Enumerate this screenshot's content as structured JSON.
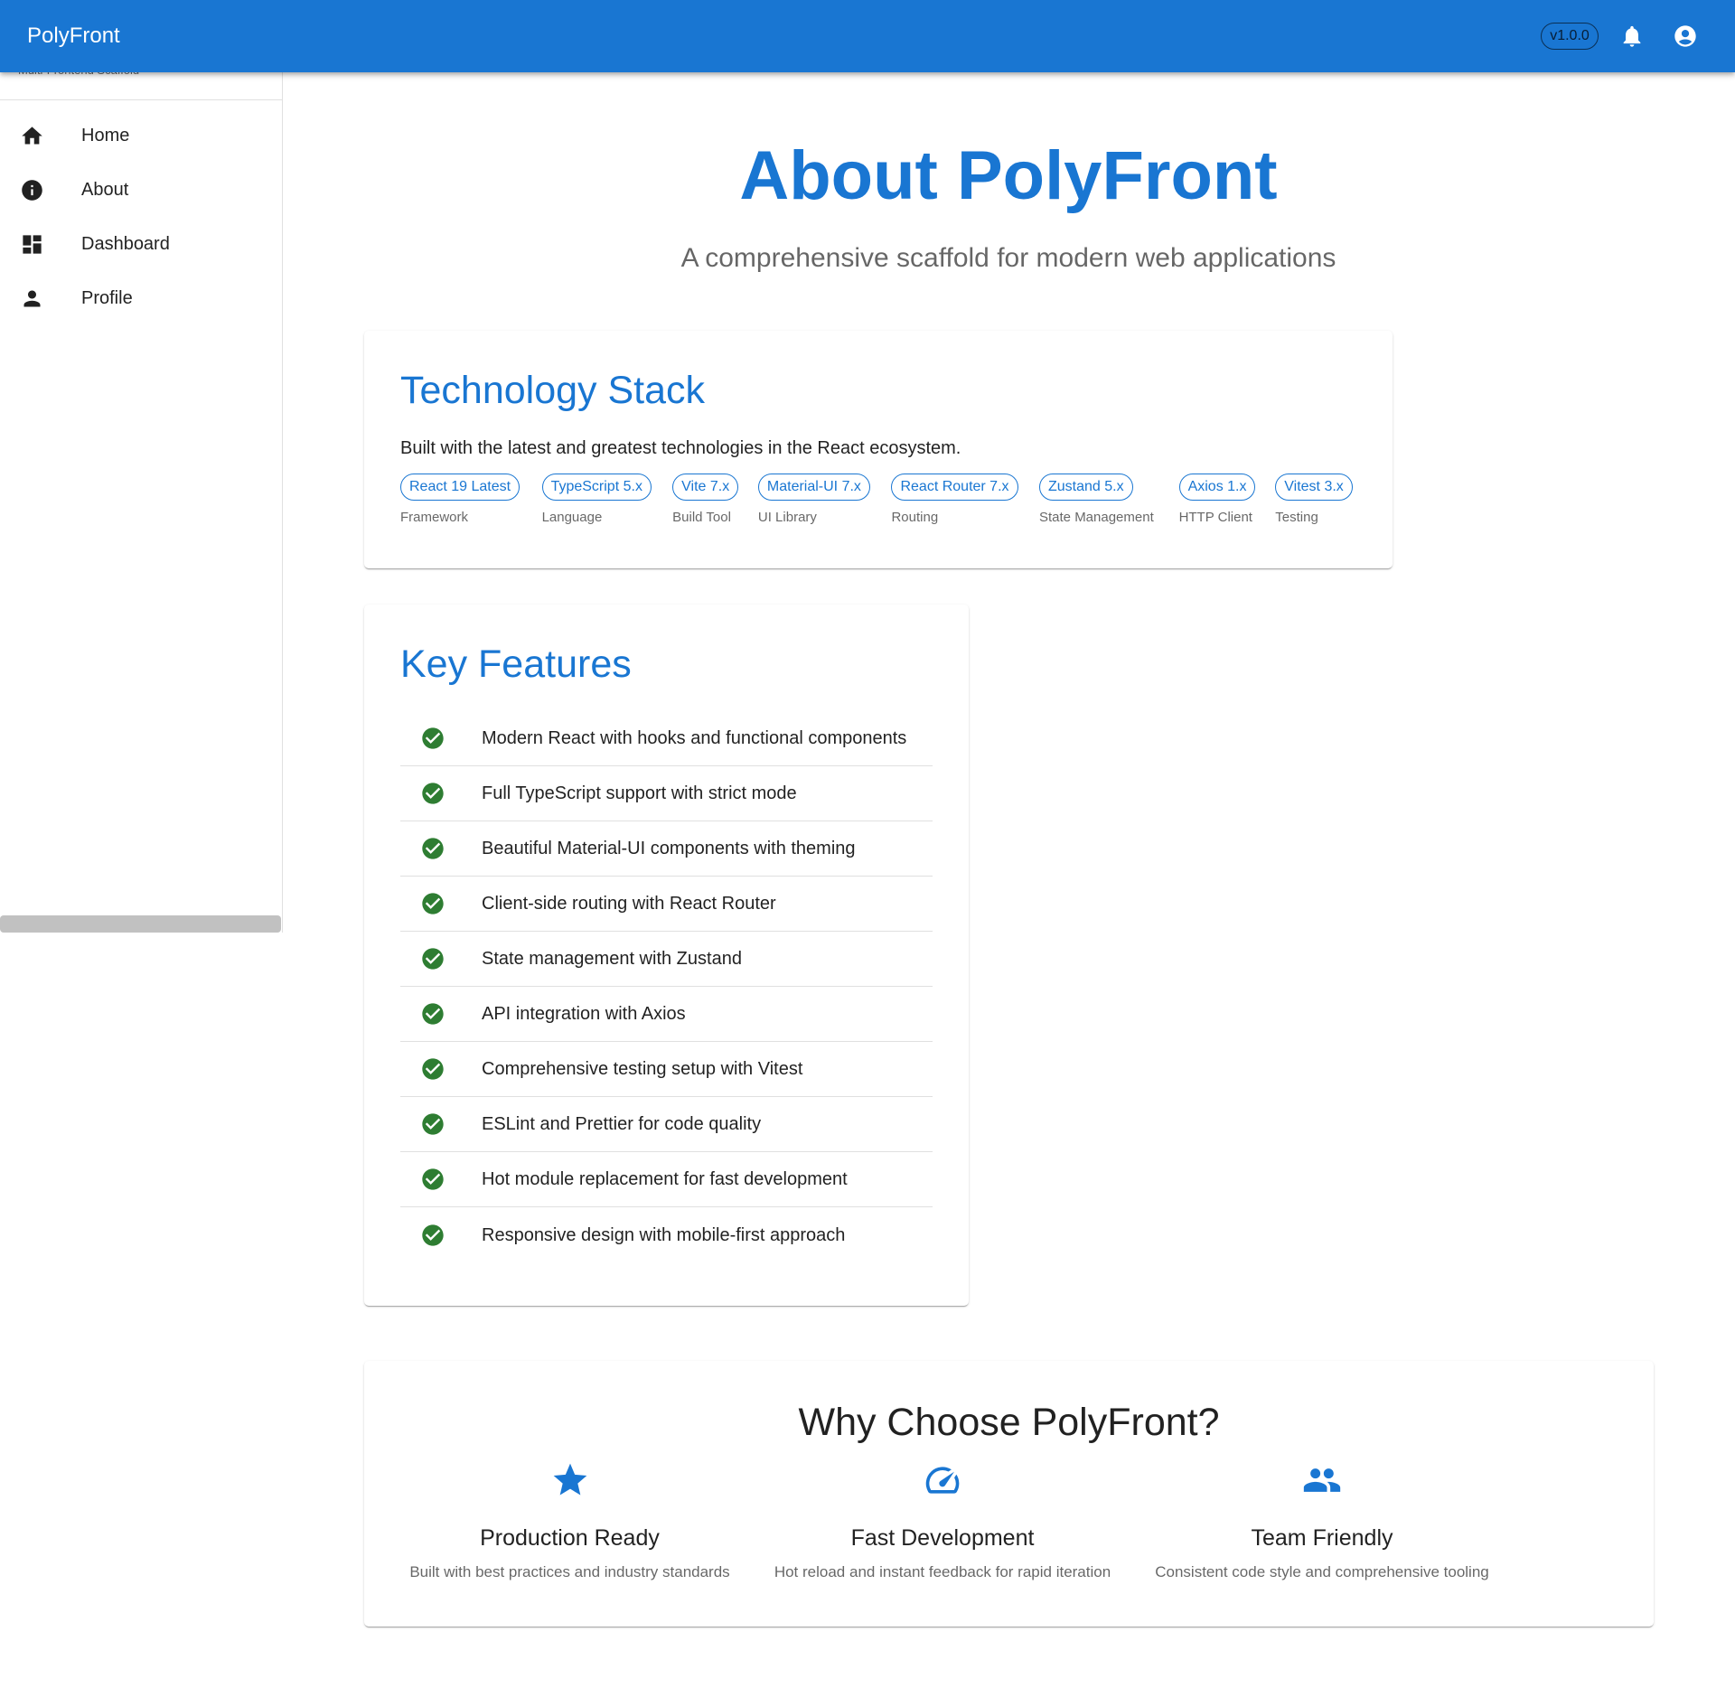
{
  "appbar": {
    "title": "PolyFront",
    "version": "v1.0.0",
    "icons": [
      "notifications-icon",
      "account-icon"
    ]
  },
  "sidebar": {
    "subtitle": "Multi-Frontend Scaffold",
    "items": [
      {
        "label": "Home",
        "icon": "home-icon"
      },
      {
        "label": "About",
        "icon": "info-icon"
      },
      {
        "label": "Dashboard",
        "icon": "dashboard-icon"
      },
      {
        "label": "Profile",
        "icon": "person-icon"
      }
    ]
  },
  "hero": {
    "title": "About PolyFront",
    "subtitle": "A comprehensive scaffold for modern web applications"
  },
  "tech": {
    "heading": "Technology Stack",
    "description": "Built with the latest and greatest technologies in the React ecosystem.",
    "items": [
      {
        "chip": "React 19 Latest",
        "category": "Framework"
      },
      {
        "chip": "TypeScript 5.x",
        "category": "Language"
      },
      {
        "chip": "Vite 7.x",
        "category": "Build Tool"
      },
      {
        "chip": "Material-UI 7.x",
        "category": "UI Library"
      },
      {
        "chip": "React Router 7.x",
        "category": "Routing"
      },
      {
        "chip": "Zustand 5.x",
        "category": "State Management"
      },
      {
        "chip": "Axios 1.x",
        "category": "HTTP Client"
      },
      {
        "chip": "Vitest 3.x",
        "category": "Testing"
      }
    ]
  },
  "features": {
    "heading": "Key Features",
    "items": [
      "Modern React with hooks and functional components",
      "Full TypeScript support with strict mode",
      "Beautiful Material-UI components with theming",
      "Client-side routing with React Router",
      "State management with Zustand",
      "API integration with Axios",
      "Comprehensive testing setup with Vitest",
      "ESLint and Prettier for code quality",
      "Hot module replacement for fast development",
      "Responsive design with mobile-first approach"
    ]
  },
  "why": {
    "title": "Why Choose PolyFront?",
    "columns": [
      {
        "icon": "star-icon",
        "title": "Production Ready",
        "description": "Built with best practices and industry standards"
      },
      {
        "icon": "speed-icon",
        "title": "Fast Development",
        "description": "Hot reload and instant feedback for rapid iteration"
      },
      {
        "icon": "people-icon",
        "title": "Team Friendly",
        "description": "Consistent code style and comprehensive tooling"
      }
    ]
  },
  "colors": {
    "primary": "#1976d2",
    "success": "#2e7d32"
  }
}
